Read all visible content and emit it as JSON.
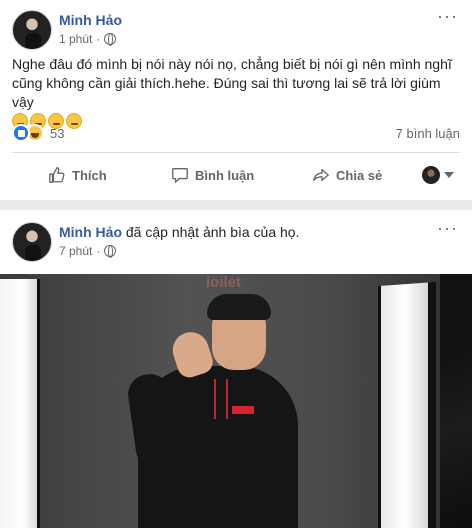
{
  "post1": {
    "author": "Minh Hảo",
    "time": "1 phút",
    "more_label": "···",
    "text": "Nghe đâu đó mình bị nói này nói nọ, chẳng biết bị nói gì nên mình nghĩ cũng không cần giải thích.hehe. Đúng sai thì tương lai sẽ trả lời giùm vậy",
    "emojis": [
      "relieved-emoji",
      "relieved-emoji",
      "relieved-emoji",
      "relieved-emoji"
    ],
    "reaction_count": "53",
    "comment_count": "7 bình luận",
    "actions": {
      "like": "Thích",
      "comment": "Bình luận",
      "share": "Chia sẻ"
    }
  },
  "post2": {
    "author": "Minh Hảo",
    "activity": "đã cập nhật ảnh bìa của họ.",
    "time": "7 phút",
    "more_label": "···",
    "watermark": "ioilet"
  },
  "colors": {
    "author_link": "#385898",
    "meta_text": "#616770",
    "like_blue": "#1877f2",
    "background": "#e9ebee"
  }
}
